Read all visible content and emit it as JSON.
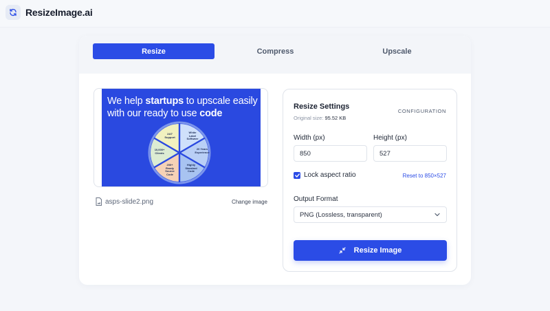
{
  "app": {
    "name": "ResizeImage.ai",
    "icon": "refresh-icon"
  },
  "tabs": [
    {
      "label": "Resize",
      "active": true
    },
    {
      "label": "Compress",
      "active": false
    },
    {
      "label": "Upscale",
      "active": false
    }
  ],
  "preview": {
    "slide": {
      "line1_pre": "We help ",
      "line1_bold": "startups",
      "line1_post": " to upscale easily",
      "line2_pre": "with our ready to use ",
      "line2_bold": "code",
      "segments": [
        "White Label Software",
        "20 Years Experience",
        "Highly Standard Code",
        "200+ Ready Source Code",
        "10,000+ Clients",
        "24/7 Support"
      ]
    },
    "file_name": "asps-slide2.png",
    "change_label": "Change image"
  },
  "settings": {
    "title": "Resize Settings",
    "original_size_label": "Original size:",
    "original_size_value": "95.52 KB",
    "config_label": "CONFIGURATION",
    "width_label": "Width (px)",
    "width_value": "850",
    "height_label": "Height (px)",
    "height_value": "527",
    "lock_label": "Lock aspect ratio",
    "lock_checked": true,
    "reset_label": "Reset to 850×527",
    "format_label": "Output Format",
    "format_value": "PNG (Lossless, transparent)",
    "button_label": "Resize Image"
  },
  "colors": {
    "accent": "#2b4ce6",
    "background": "#f4f6fa",
    "card": "#ffffff"
  }
}
